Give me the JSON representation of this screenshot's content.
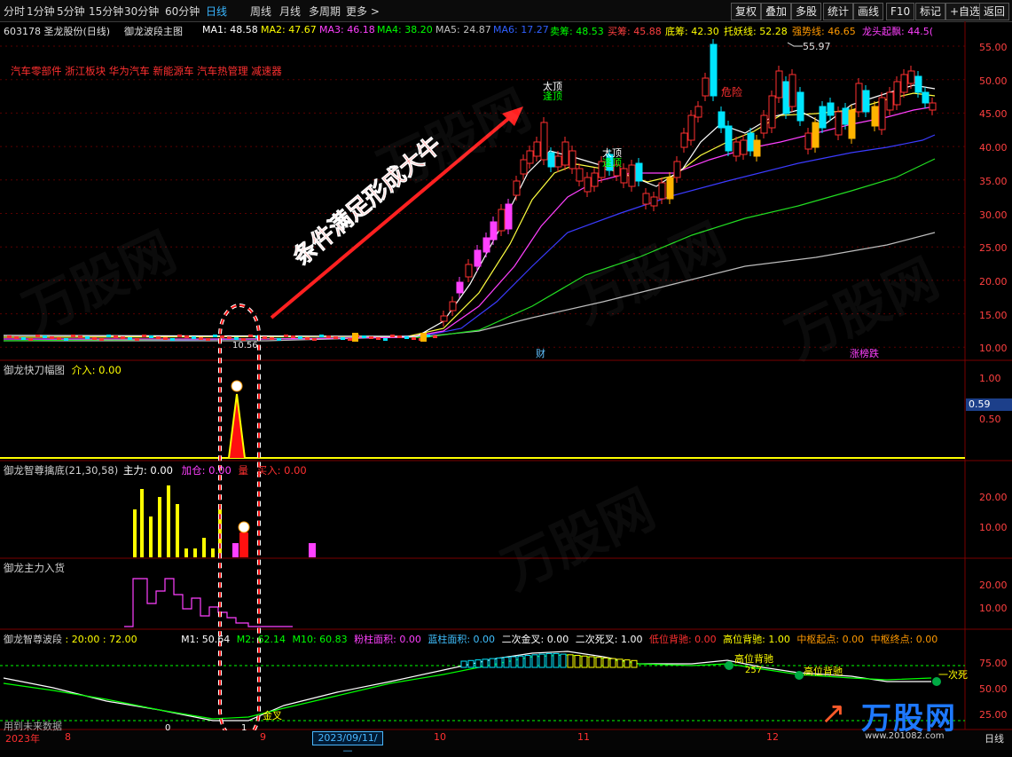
{
  "toolbar": {
    "periods": [
      "分时",
      "1分钟",
      "5分钟",
      "15分钟",
      "30分钟",
      "60分钟",
      "日线",
      "周线",
      "月线",
      "多周期",
      "更多 >"
    ],
    "active": "日线",
    "right_buttons": [
      "复权",
      "叠加",
      "多股",
      "统计",
      "画线",
      "F10",
      "标记",
      "+自选",
      "返回"
    ]
  },
  "title": {
    "stock": "603178 圣龙股份(日线)",
    "indicator": "御龙波段主图",
    "items": [
      {
        "label": "MA1: 48.58",
        "color": "#ffffff"
      },
      {
        "label": "MA2: 47.67",
        "color": "#ffff00"
      },
      {
        "label": "MA3: 46.18",
        "color": "#ff40ff"
      },
      {
        "label": "MA4: 38.20",
        "color": "#00ff00"
      },
      {
        "label": "MA5: 24.87",
        "color": "#c0c0c0"
      },
      {
        "label": "MA6: 17.27",
        "color": "#3060ff"
      },
      {
        "label": "卖筹: 48.53",
        "color": "#00ff00"
      },
      {
        "label": "买筹: 45.88",
        "color": "#ff4040"
      },
      {
        "label": "底筹: 42.30",
        "color": "#ffff00"
      },
      {
        "label": "托妖线: 52.28",
        "color": "#ffff00"
      },
      {
        "label": "强势线: 46.65",
        "color": "#ff9900"
      },
      {
        "label": "龙头起飘: 44.5(",
        "color": "#ff40ff"
      }
    ]
  },
  "sector_tags": "汽车零部件 浙江板块 华为汽车 新能源车 汽车热管理 减速器",
  "annotation": "条件满足形成大牛",
  "main_axis": [
    "55.00",
    "50.00",
    "45.00",
    "40.00",
    "35.00",
    "30.00",
    "25.00",
    "20.00",
    "15.00",
    "10.00"
  ],
  "markers": {
    "peak1_top": "太顶",
    "peak1_sub": "逢顶",
    "peak2_top": "太顶",
    "peak2_sub": "逢顶",
    "danger": "危险",
    "high_price": "55.97",
    "low_price": "10.56",
    "cai": "财",
    "zhangting": "涨榜跌"
  },
  "pane2": {
    "title": "御龙快刀幅图",
    "value": "介入: 0.00",
    "axis": [
      "1.00",
      "0.50"
    ],
    "cursor": "0.59"
  },
  "pane3": {
    "title": "御龙智尊擒底(21,30,58)",
    "zhuli": "主力: 0.00",
    "jiacang": "加仓: 0.00",
    "liang": "量",
    "mairu": "买入: 0.00",
    "axis": [
      "20.00",
      "10.00"
    ]
  },
  "pane4": {
    "title": "御龙主力入货",
    "axis": [
      "20.00",
      "10.00"
    ]
  },
  "pane5": {
    "title": "御龙智尊波段",
    "vals": ": 20:00 : 72.00",
    "m1": "M1: 50.64",
    "m2": "M2: 62.14",
    "m10": "M10: 60.83",
    "fen": "粉柱面积: 0.00",
    "lan": "蓝柱面积: 0.00",
    "erjin": "二次金叉: 0.00",
    "ersi": "二次死叉: 1.00",
    "dibei": "低位背驰: 0.00",
    "gaobei": "高位背驰: 1.00",
    "zqd": "中枢起点: 0.00",
    "zzd": "中枢终点: 0.00",
    "axis": [
      "75.00",
      "50.00",
      "25.00"
    ],
    "labels": {
      "jincha": "金叉",
      "gaowei1": "高位背驰",
      "num257": "257",
      "gaowei2": "高位背驰",
      "yicisi": "一次死",
      "zero": "0",
      "one": "1"
    }
  },
  "bottom": {
    "footer": "用到未来数据",
    "year": "2023年",
    "months": [
      "8",
      "9",
      "10",
      "11",
      "12"
    ],
    "date": "2023/09/11/—",
    "period": "日线"
  },
  "watermark": "万股网",
  "site": "www.201082.com"
}
